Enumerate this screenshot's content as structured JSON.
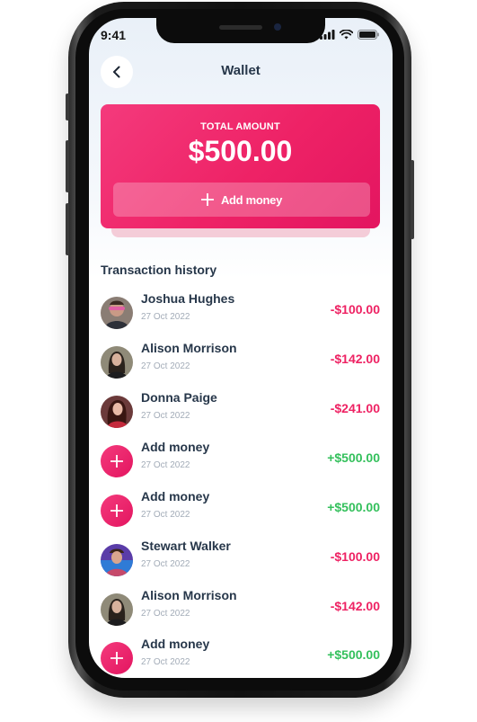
{
  "status_bar": {
    "time": "9:41"
  },
  "header": {
    "title": "Wallet"
  },
  "balance_card": {
    "label": "TOTAL AMOUNT",
    "amount": "$500.00",
    "add_money_label": "Add money"
  },
  "history": {
    "title": "Transaction history",
    "items": [
      {
        "name": "Joshua Hughes",
        "date": "27 Oct 2022",
        "amount": "-$100.00",
        "type": "debit",
        "avatar": "avatar-joshua"
      },
      {
        "name": "Alison Morrison",
        "date": "27 Oct 2022",
        "amount": "-$142.00",
        "type": "debit",
        "avatar": "avatar-alison"
      },
      {
        "name": "Donna Paige",
        "date": "27 Oct 2022",
        "amount": "-$241.00",
        "type": "debit",
        "avatar": "avatar-donna"
      },
      {
        "name": "Add money",
        "date": "27 Oct 2022",
        "amount": "+$500.00",
        "type": "credit",
        "avatar": "plus-icon"
      },
      {
        "name": "Add money",
        "date": "27 Oct 2022",
        "amount": "+$500.00",
        "type": "credit",
        "avatar": "plus-icon"
      },
      {
        "name": "Stewart Walker",
        "date": "27 Oct 2022",
        "amount": "-$100.00",
        "type": "debit",
        "avatar": "avatar-stewart"
      },
      {
        "name": "Alison Morrison",
        "date": "27 Oct 2022",
        "amount": "-$142.00",
        "type": "debit",
        "avatar": "avatar-alison"
      },
      {
        "name": "Add money",
        "date": "27 Oct 2022",
        "amount": "+$500.00",
        "type": "credit",
        "avatar": "plus-icon"
      }
    ]
  },
  "colors": {
    "accent": "#ee2263",
    "positive": "#34c05c",
    "text_dark": "#27374a",
    "text_muted": "#a3acb8"
  }
}
